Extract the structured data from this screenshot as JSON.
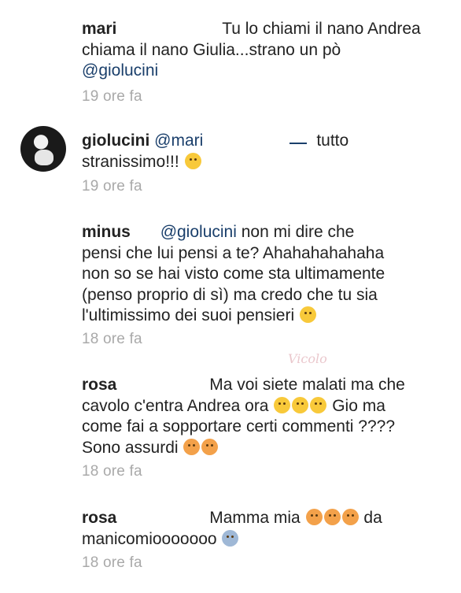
{
  "comments": [
    {
      "user": "mari",
      "parts": [
        "Tu lo chiami il nano Andrea chiama il nano Giulia...strano un pò"
      ],
      "mention": "@giolucini",
      "time": "19 ore fa"
    },
    {
      "user": "giolucini",
      "mention": "@mari",
      "parts": [
        "tutto",
        "stranissimo!!!"
      ],
      "emoji": "smirk-emoji",
      "time": "19 ore fa"
    },
    {
      "user": "minus",
      "mention": "@giolucini",
      "parts": [
        "non mi dire che",
        "pensi che lui pensi a te? Ahahahahahaha",
        "non so se hai visto come sta ultimamente",
        "(penso proprio di sì) ma credo che tu sia",
        "l'ultimissimo dei suoi pensieri"
      ],
      "emoji": "laughing-emoji",
      "time": "18 ore fa"
    },
    {
      "user": "rosa",
      "parts": [
        "Ma voi siete malati ma che",
        "cavolo c'entra Andrea ora",
        "Gio  ma",
        "come fai a sopportare certi commenti ????",
        "Sono assurdi"
      ],
      "time": "18 ore fa"
    },
    {
      "user": "rosa",
      "parts": [
        "Mamma  mia",
        "da",
        "manicomiooooooo"
      ],
      "time": "18 ore fa"
    }
  ],
  "watermark": "Vicolo"
}
